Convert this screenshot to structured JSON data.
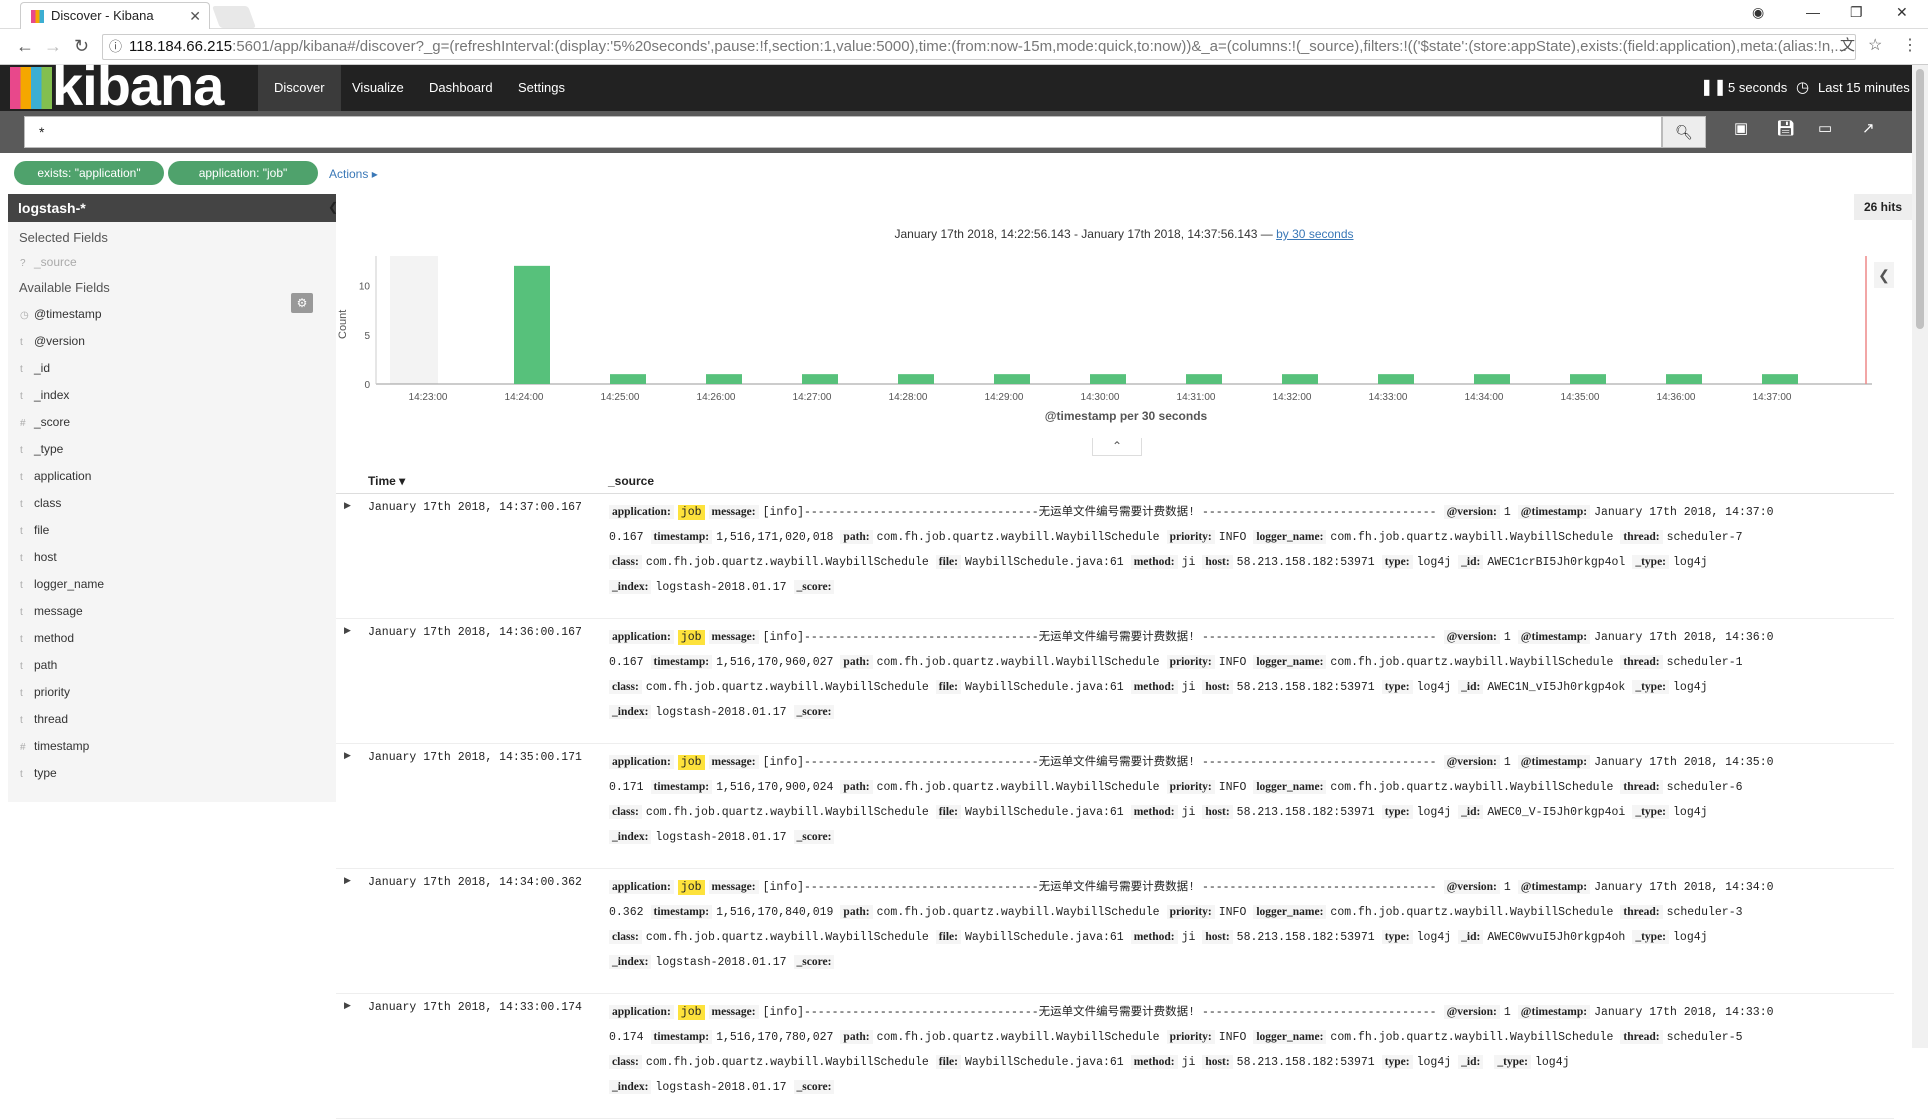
{
  "browser": {
    "tab_title": "Discover - Kibana",
    "url_host": "118.184.66.215",
    "url_rest": ":5601/app/kibana#/discover?_g=(refreshInterval:(display:'5%20seconds',pause:!f,section:1,value:5000),time:(from:now-15m,mode:quick,to:now))&_a=(columns:!(_source),filters:!(('$state':(store:appState),exists:(field:application),meta:(alias:!n,..."
  },
  "nav": {
    "logo": "kibana",
    "links": [
      "Discover",
      "Visualize",
      "Dashboard",
      "Settings"
    ],
    "refresh_interval": "5 seconds",
    "time_range": "Last 15 minutes"
  },
  "query": {
    "value": "*"
  },
  "filters": [
    {
      "label": "exists: \"application\""
    },
    {
      "label": "application: \"job\""
    }
  ],
  "actions_label": "Actions",
  "sidebar": {
    "index_pattern": "logstash-*",
    "selected_heading": "Selected Fields",
    "selected_fields": [
      {
        "type": "?",
        "name": "_source"
      }
    ],
    "available_heading": "Available Fields",
    "available_fields": [
      {
        "type": "◷",
        "name": "@timestamp"
      },
      {
        "type": "t",
        "name": "@version"
      },
      {
        "type": "t",
        "name": "_id"
      },
      {
        "type": "t",
        "name": "_index"
      },
      {
        "type": "#",
        "name": "_score"
      },
      {
        "type": "t",
        "name": "_type"
      },
      {
        "type": "t",
        "name": "application"
      },
      {
        "type": "t",
        "name": "class"
      },
      {
        "type": "t",
        "name": "file"
      },
      {
        "type": "t",
        "name": "host"
      },
      {
        "type": "t",
        "name": "logger_name"
      },
      {
        "type": "t",
        "name": "message"
      },
      {
        "type": "t",
        "name": "method"
      },
      {
        "type": "t",
        "name": "path"
      },
      {
        "type": "t",
        "name": "priority"
      },
      {
        "type": "t",
        "name": "thread"
      },
      {
        "type": "#",
        "name": "timestamp"
      },
      {
        "type": "t",
        "name": "type"
      }
    ]
  },
  "results": {
    "hits": "26 hits",
    "range_text": "January 17th 2018, 14:22:56.143 - January 17th 2018, 14:37:56.143 —",
    "interval_link": "by 30 seconds",
    "col_time": "Time",
    "col_source": "_source"
  },
  "chart_data": {
    "type": "bar",
    "ylabel": "Count",
    "xlabel": "@timestamp per 30 seconds",
    "ylim": [
      0,
      13
    ],
    "yticks": [
      0,
      5,
      10
    ],
    "xticks": [
      "14:23:00",
      "14:24:00",
      "14:25:00",
      "14:26:00",
      "14:27:00",
      "14:28:00",
      "14:29:00",
      "14:30:00",
      "14:31:00",
      "14:32:00",
      "14:33:00",
      "14:34:00",
      "14:35:00",
      "14:36:00",
      "14:37:00"
    ],
    "categories": [
      "14:24:00",
      "14:25:00",
      "14:26:00",
      "14:27:00",
      "14:28:00",
      "14:29:00",
      "14:30:00",
      "14:31:00",
      "14:32:00",
      "14:33:00",
      "14:34:00",
      "14:35:00",
      "14:36:00",
      "14:37:00"
    ],
    "values": [
      12,
      1,
      1,
      1,
      1,
      1,
      1,
      1,
      1,
      1,
      1,
      1,
      1,
      1
    ],
    "bar_color": "#57c17b"
  },
  "rows": [
    {
      "time": "January 17th 2018, 14:37:00.167",
      "version_ts": "January 17th 2018, 14:37:0",
      "ts_frac": "0.167",
      "timestamp": "1,516,171,020,018",
      "thread": "scheduler-7",
      "id": "AWEC1crBI5Jh0rkgp4ol"
    },
    {
      "time": "January 17th 2018, 14:36:00.167",
      "version_ts": "January 17th 2018, 14:36:0",
      "ts_frac": "0.167",
      "timestamp": "1,516,170,960,027",
      "thread": "scheduler-1",
      "id": "AWEC1N_vI5Jh0rkgp4ok"
    },
    {
      "time": "January 17th 2018, 14:35:00.171",
      "version_ts": "January 17th 2018, 14:35:0",
      "ts_frac": "0.171",
      "timestamp": "1,516,170,900,024",
      "thread": "scheduler-6",
      "id": "AWEC0_V-I5Jh0rkgp4oi"
    },
    {
      "time": "January 17th 2018, 14:34:00.362",
      "version_ts": "January 17th 2018, 14:34:0",
      "ts_frac": "0.362",
      "timestamp": "1,516,170,840,019",
      "thread": "scheduler-3",
      "id": "AWEC0wvuI5Jh0rkgp4oh"
    },
    {
      "time": "January 17th 2018, 14:33:00.174",
      "version_ts": "January 17th 2018, 14:33:0",
      "ts_frac": "0.174",
      "timestamp": "1,516,170,780,027",
      "thread": "scheduler-5",
      "id": ""
    }
  ],
  "common": {
    "application": "job",
    "message": "[info]----------------------------------无运单文件编号需要计费数据! ----------------------------------",
    "version": "1",
    "path": "com.fh.job.quartz.waybill.WaybillSchedule",
    "priority": "INFO",
    "logger_name": "com.fh.job.quartz.waybill.WaybillSchedule",
    "class": "com.fh.job.quartz.waybill.WaybillSchedule",
    "file": "WaybillSchedule.java:61",
    "method": "ji",
    "host": "58.213.158.182:53971",
    "type": "log4j",
    "index": "logstash-2018.01.17",
    "score": ""
  },
  "labels": {
    "application": "application:",
    "message": "message:",
    "version": "@version:",
    "timestamp_at": "@timestamp:",
    "timestamp": "timestamp:",
    "path": "path:",
    "priority": "priority:",
    "logger_name": "logger_name:",
    "thread": "thread:",
    "class": "class:",
    "file": "file:",
    "method": "method:",
    "host": "host:",
    "type": "type:",
    "id": "_id:",
    "_type": "_type:",
    "index": "_index:",
    "score": "_score:"
  }
}
